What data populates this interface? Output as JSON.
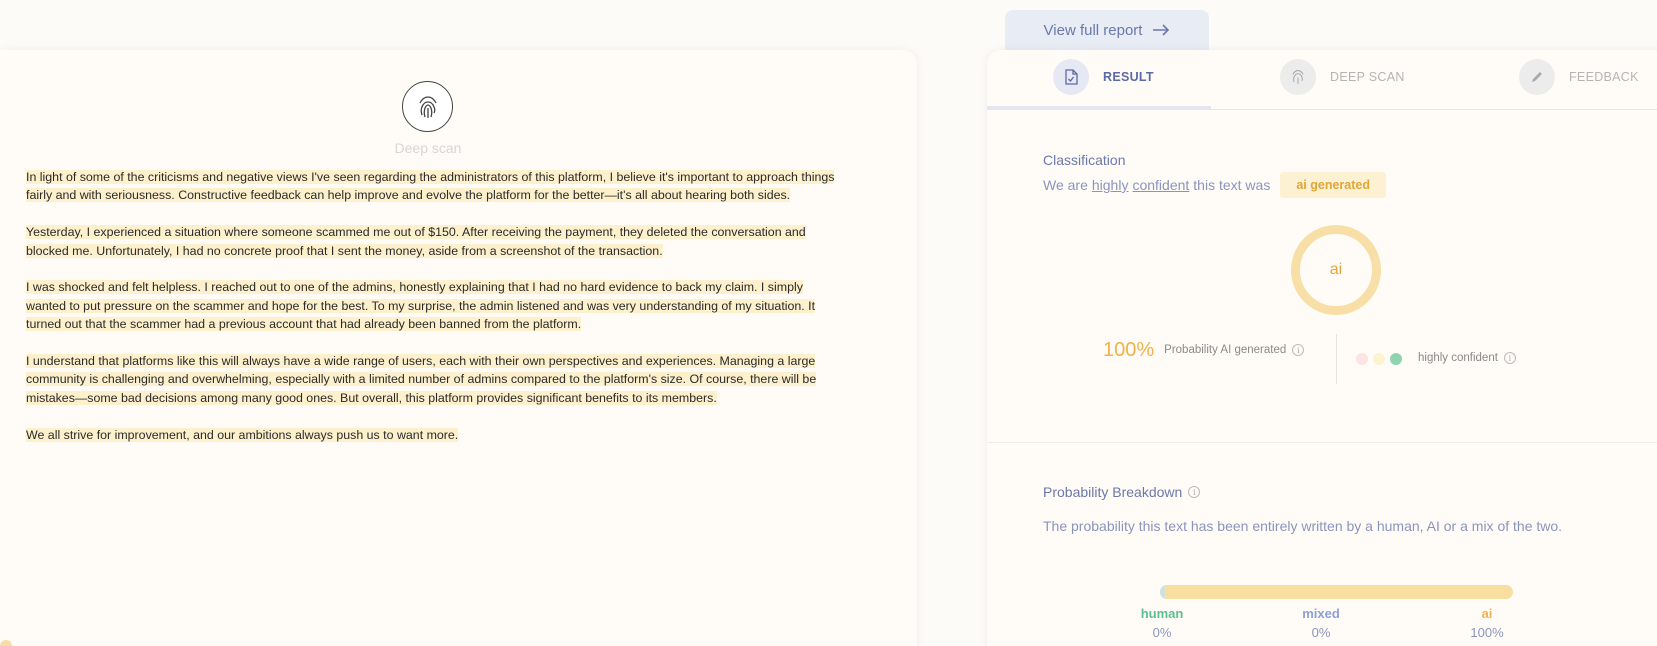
{
  "view_report": {
    "label": "View full report"
  },
  "tabs": [
    {
      "label": "RESULT",
      "icon": "document-icon"
    },
    {
      "label": "DEEP SCAN",
      "icon": "fingerprint-icon"
    },
    {
      "label": "FEEDBACK",
      "icon": "pencil-icon"
    }
  ],
  "left": {
    "deep_scan_label": "Deep scan",
    "paragraphs": [
      "In light of some of the criticisms and negative views I've seen regarding the administrators of this platform, I believe it's important to approach things fairly and with seriousness. Constructive feedback can help improve and evolve the platform for the better—it's all about hearing both sides.",
      "Yesterday, I experienced a situation where someone scammed me out of $150. After receiving the payment, they deleted the conversation and blocked me. Unfortunately, I had no concrete proof that I sent the money, aside from a screenshot of the transaction.",
      "I was shocked and felt helpless. I reached out to one of the admins, honestly explaining that I had no hard evidence to back my claim. I simply wanted to put pressure on the scammer and hope for the best. To my surprise, the admin listened and was very understanding of my situation. It turned out that the scammer had a previous account that had already been banned from the platform.",
      "I understand that platforms like this will always have a wide range of users, each with their own perspectives and experiences. Managing a large community is challenging and overwhelming, especially with a limited number of admins compared to the platform's size. Of course, there will be mistakes—some bad decisions among many good ones. But overall, this platform provides significant benefits to its members.",
      "We all strive for improvement, and our ambitions always push us to want more."
    ]
  },
  "classification": {
    "title": "Classification",
    "prefix": "We are",
    "word1": "highly",
    "word2": "confident",
    "suffix": "this text was",
    "badge": "ai generated",
    "ring_label": "ai",
    "prob_value": "100%",
    "prob_label": "Probability AI generated",
    "confidence_label": "highly confident",
    "confidence_colors": [
      "#fde3e3",
      "#fdf3cf",
      "#8fd3b1"
    ]
  },
  "breakdown": {
    "title": "Probability Breakdown",
    "description": "The probability this text has been entirely written by a human, AI or a mix of the two.",
    "items": [
      {
        "label": "human",
        "value": "0%",
        "color": "#5cbf8f"
      },
      {
        "label": "mixed",
        "value": "0%",
        "color": "#8d9fd9"
      },
      {
        "label": "ai",
        "value": "100%",
        "color": "#efb24a"
      }
    ]
  }
}
